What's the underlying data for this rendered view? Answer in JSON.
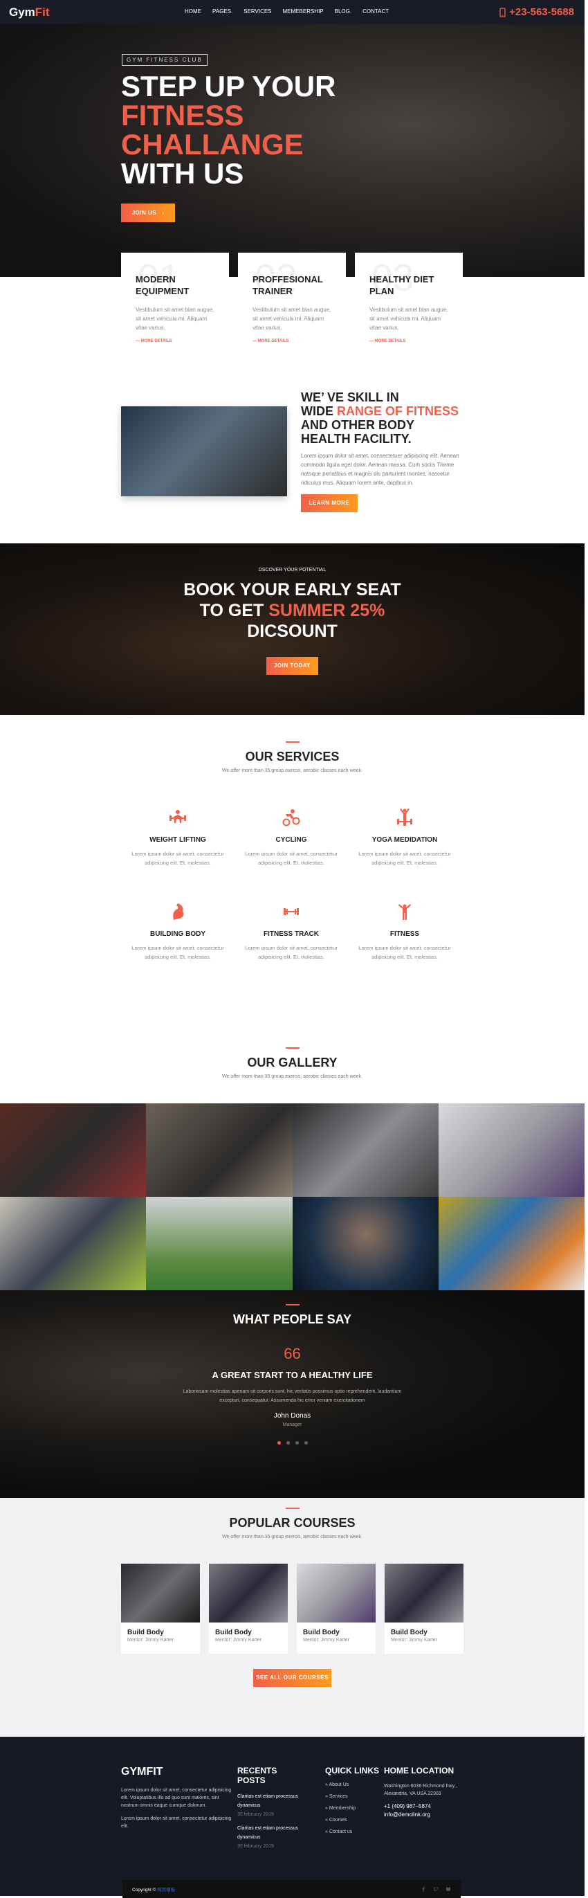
{
  "nav": {
    "logo_a": "Gym",
    "logo_b": "Fit",
    "menu": [
      "HOME",
      "PAGES.",
      "SERVICES",
      "MEMEBERSHIP",
      "BLOG.",
      "CONTACT"
    ],
    "phone": "+23-563-5688",
    "phone_icon": "mobile-phone-icon"
  },
  "hero": {
    "tag": "GYM FITNESS CLUB",
    "line1": "STEP UP YOUR",
    "line2": "FITNESS",
    "line3": "CHALLANGE",
    "line4": "WITH US",
    "button": "JOIN US",
    "button_icon": "chevron-right-icon"
  },
  "features": [
    {
      "num": "01",
      "title": "MODERN EQUIPMENT",
      "text": "Vestibulum sit amet blan augue, sit amet vehicula mi. Aliquam vitae varius.",
      "link": "— MORE DETAILS"
    },
    {
      "num": "02",
      "title": "PROFFESIONAL TRAINER",
      "text": "Vestibulum sit amet blan augue, sit amet vehicula mi. Aliquam vitae varius.",
      "link": "— MORE DETAILS"
    },
    {
      "num": "03",
      "title": "HEALTHY DIET PLAN",
      "text": "Vestibulum sit amet blan augue, sit amet vehicula mi. Aliquam vitae varius.",
      "link": "— MORE DETAILS"
    }
  ],
  "about": {
    "t1": "WE’  VE SKILL IN",
    "t2a": "WIDE ",
    "t2b": "RANGE OF FITNESS",
    "t3": "AND OTHER BODY",
    "t4": "HEALTH FACILITY.",
    "text": "Lorem ipsum dolor sit amet, consectetuer adipiscing elit. Aenean commodo ligula eget dolor. Aenean massa. Cum sociis Theme natoque penatibus et magnis dis parturient montes, nascetur ridiculus mus. Aliquam lorem ante, dapibus in.",
    "button": "LEARN MORE"
  },
  "banner": {
    "sub": "DSCOVER YOUR POTENTIAL",
    "l1": "BOOK YOUR EARLY SEAT",
    "l2a": "TO GET ",
    "l2b": "SUMMER 25%",
    "l3": "DICSOUNT",
    "button": "JOIN TODAY"
  },
  "services": {
    "title": "OUR SERVICES",
    "subtitle": "We offer more than 35 group exercis, aerobic classes each week.",
    "items": [
      {
        "icon": "weight-lifting-icon",
        "title": "WEIGHT LIFTING",
        "text": "Lorem ipsum dolor sit amet, consectetur adipisicing elit. Et, molestias."
      },
      {
        "icon": "cycling-icon",
        "title": "CYCLING",
        "text": "Lorem ipsum dolor sit amet, consectetur adipisicing elit. Et, molestias."
      },
      {
        "icon": "yoga-icon",
        "title": "YOGA MEDIDATION",
        "text": "Lorem ipsum dolor sit amet, consectetur adipisicing elit. Et, molestias."
      },
      {
        "icon": "bicep-icon",
        "title": "BUILDING BODY",
        "text": "Lorem ipsum dolor sit amet, consectetur adipisicing elit. Et, molestias."
      },
      {
        "icon": "dumbbell-icon",
        "title": "FITNESS TRACK",
        "text": "Lorem ipsum dolor sit amet, consectetur adipisicing elit. Et, molestias."
      },
      {
        "icon": "fitness-person-icon",
        "title": "FITNESS",
        "text": "Lorem ipsum dolor sit amet, consectetur adipisicing elit. Et, molestias."
      }
    ]
  },
  "gallery": {
    "title": "OUR GALLERY",
    "subtitle": "We offer more than 35 group exercis, aerobic classes each week."
  },
  "testimonial": {
    "title": "WHAT PEOPLE SAY",
    "quote": "66",
    "headline": "A GREAT START TO A HEALTHY LIFE",
    "text": "Laboriosam molestias aperiam sit corporis sunt, hic veritatis possimus optio reprehenderit, laudantium excepturi, consequatur. Assumenda hic error veniam exercitationem",
    "name": "John Donas",
    "role": "Manager",
    "slides": 4,
    "active_slide": 1
  },
  "courses": {
    "title": "POPULAR COURSES",
    "subtitle": "We offer more than 35 group exercis, aerobic classes each week.",
    "items": [
      {
        "title": "Build Body",
        "mentor": "Mentor: Jimmy Karter"
      },
      {
        "title": "Build Body",
        "mentor": "Mentor: Jimmy Karter"
      },
      {
        "title": "Build Body",
        "mentor": "Mentor: Jimmy Karter"
      },
      {
        "title": "Build Body",
        "mentor": "Mentor: Jimmy Karter"
      }
    ],
    "button": "SEE ALL OUR COURSES"
  },
  "footer": {
    "brand": "GYMFIT",
    "p1": "Lorem ipsum dolor sit amet, consectetur adipisicing elit. Voluptatibus illo ad quo sunt maiores, sint nostrum omnis eaque cumque dolorum.",
    "p2": "Lorem ipsum dolor sit amet, consectetur adipisicing elit.",
    "posts_title": "RECENTS POSTS",
    "posts": [
      {
        "title": "Claritas est etiam processus dynamicus",
        "date": "30 february 2019"
      },
      {
        "title": "Claritas est etiam processus dynamicus",
        "date": "30 february 2019"
      }
    ],
    "links_title": "QUICK LINKS",
    "links": [
      "About Us",
      "Services",
      "Membership",
      "Courses",
      "Contact us"
    ],
    "loc_title": "HOME LOCATION",
    "address": "Washington 6036 Richmond hwy., Alexandria, VA USA 22303",
    "tel": "+1 (409) 987–5874",
    "email": "info@demolink.org",
    "copyright": "Copyright © ",
    "copyright_link": "网页模板",
    "social": [
      "facebook-icon",
      "twitter-icon",
      "github-icon"
    ]
  },
  "colors": {
    "accent": "#f0604a",
    "accent2": "#ff9b1e",
    "dark": "#191b26",
    "footer": "#171a24"
  }
}
